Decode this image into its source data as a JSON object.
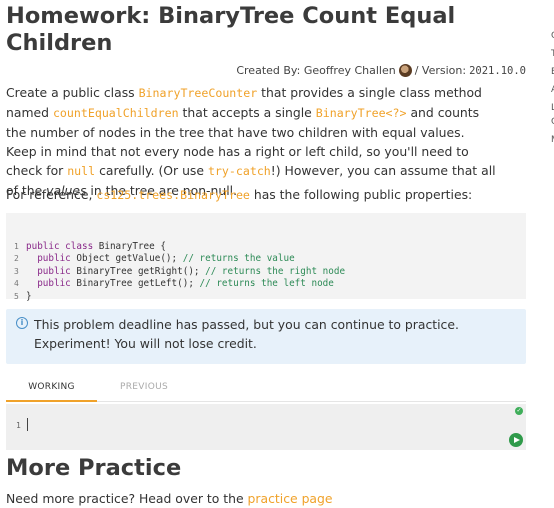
{
  "title": "Homework: BinaryTree Count Equal Children",
  "byline": {
    "created_by_label": "Created By: Geoffrey Challen",
    "version_label": "/ Version:",
    "version": "2021.10.0"
  },
  "description": {
    "t1": "Create a public class ",
    "c1": "BinaryTreeCounter",
    "t2": " that provides a single class method named ",
    "c2": "countEqualChildren",
    "t3": " that accepts a single ",
    "c3": "BinaryTree<?>",
    "t4": " and counts the number of nodes in the tree that have two children with equal values. Keep in mind that not every node has a right or left child, so you'll need to check for ",
    "c4": "null",
    "t5": " carefully. (Or use ",
    "c5": "try-catch",
    "t6": "!) However, you can assume that all of the ",
    "em1": "values",
    "t7": " in the tree are non-null."
  },
  "reference": {
    "t1": "For reference, ",
    "c1": "cs125.trees.BinaryTree",
    "t2": " has the following public properties:"
  },
  "code_lines": [
    {
      "n": "1",
      "kw": "public class",
      "rest": " BinaryTree {",
      "comment": ""
    },
    {
      "n": "2",
      "kw": "  public",
      "rest": " Object getValue(); ",
      "comment": "// returns the value"
    },
    {
      "n": "3",
      "kw": "  public",
      "rest": " BinaryTree getRight(); ",
      "comment": "// returns the right node"
    },
    {
      "n": "4",
      "kw": "  public",
      "rest": " BinaryTree getLeft(); ",
      "comment": "// returns the left node"
    },
    {
      "n": "5",
      "kw": "",
      "rest": "}",
      "comment": ""
    }
  ],
  "alert": {
    "icon": "info-icon",
    "text": "This problem deadline has passed, but you can continue to practice. Experiment! You will not lose credit."
  },
  "tabs": [
    {
      "label": "WORKING",
      "active": true
    },
    {
      "label": "PREVIOUS",
      "active": false
    }
  ],
  "editor": {
    "line_number": "1",
    "value": ""
  },
  "more_practice": {
    "heading": "More Practice",
    "text": "Need more practice? Head over to the ",
    "link": "practice page"
  },
  "colors": {
    "accent": "#f0a22a",
    "alert_bg": "#e7f1fa",
    "code_bg": "#f3f3f3",
    "run_button": "#2f9a4a"
  }
}
